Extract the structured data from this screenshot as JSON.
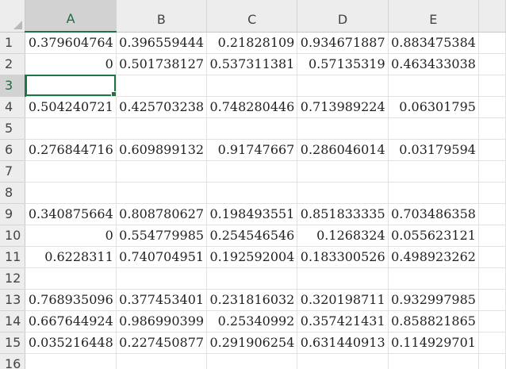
{
  "columns": [
    "A",
    "B",
    "C",
    "D",
    "E"
  ],
  "active_cell": "A3",
  "rows": [
    {
      "num": "1",
      "cells": [
        "0.379604764",
        "0.396559444",
        "0.21828109",
        "0.934671887",
        "0.883475384"
      ]
    },
    {
      "num": "2",
      "cells": [
        "0",
        "0.501738127",
        "0.537311381",
        "0.57135319",
        "0.463433038"
      ]
    },
    {
      "num": "3",
      "cells": [
        "",
        "",
        "",
        "",
        ""
      ]
    },
    {
      "num": "4",
      "cells": [
        "0.504240721",
        "0.425703238",
        "0.748280446",
        "0.713989224",
        "0.06301795"
      ]
    },
    {
      "num": "5",
      "cells": [
        "",
        "",
        "",
        "",
        ""
      ]
    },
    {
      "num": "6",
      "cells": [
        "0.276844716",
        "0.609899132",
        "0.91747667",
        "0.286046014",
        "0.03179594"
      ]
    },
    {
      "num": "7",
      "cells": [
        "",
        "",
        "",
        "",
        ""
      ]
    },
    {
      "num": "8",
      "cells": [
        "",
        "",
        "",
        "",
        ""
      ]
    },
    {
      "num": "9",
      "cells": [
        "0.340875664",
        "0.808780627",
        "0.198493551",
        "0.851833335",
        "0.703486358"
      ]
    },
    {
      "num": "10",
      "cells": [
        "0",
        "0.554779985",
        "0.254546546",
        "0.1268324",
        "0.055623121"
      ]
    },
    {
      "num": "11",
      "cells": [
        "0.6228311",
        "0.740704951",
        "0.192592004",
        "0.183300526",
        "0.498923262"
      ]
    },
    {
      "num": "12",
      "cells": [
        "",
        "",
        "",
        "",
        ""
      ]
    },
    {
      "num": "13",
      "cells": [
        "0.768935096",
        "0.377453401",
        "0.231816032",
        "0.320198711",
        "0.932997985"
      ]
    },
    {
      "num": "14",
      "cells": [
        "0.667644924",
        "0.986990399",
        "0.25340992",
        "0.357421431",
        "0.858821865"
      ]
    },
    {
      "num": "15",
      "cells": [
        "0.035216448",
        "0.227450877",
        "0.291906254",
        "0.631440913",
        "0.114929701"
      ]
    },
    {
      "num": "16",
      "cells": [
        "",
        "",
        "",
        "",
        ""
      ]
    }
  ]
}
